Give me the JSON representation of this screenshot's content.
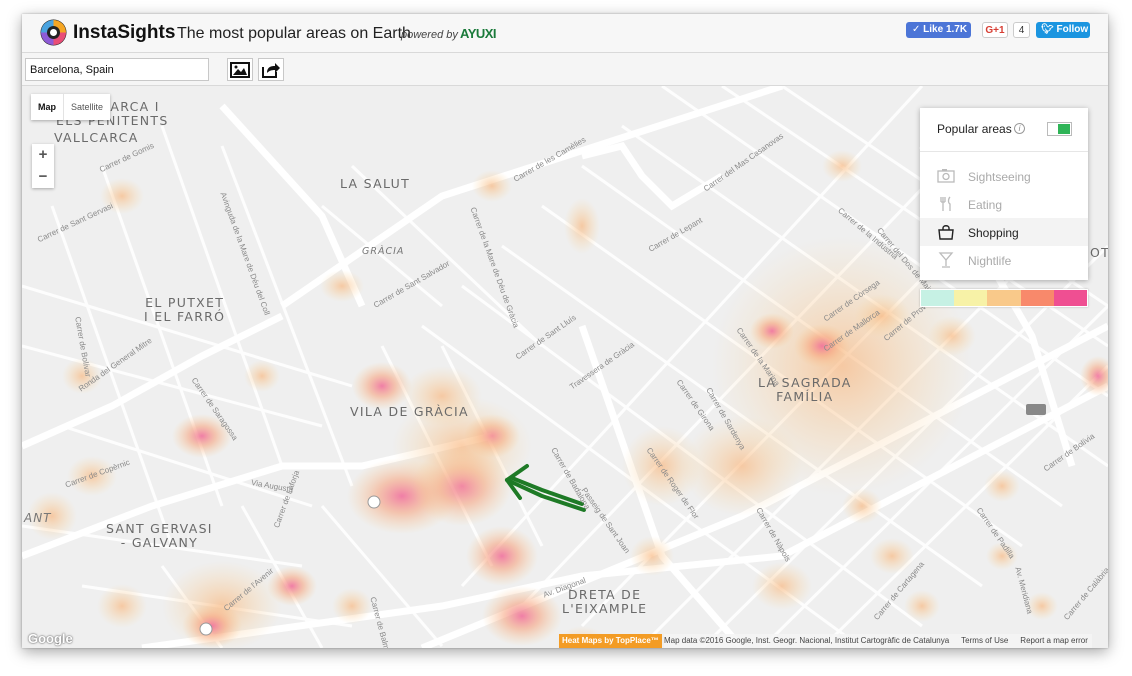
{
  "header": {
    "brand": "InstaSights",
    "tagline": "The most popular areas on Earth",
    "powered_by": "powered by",
    "partner": "AYUXI"
  },
  "social": {
    "like_label": "Like 1.7K",
    "gplus_label": "G+1",
    "gplus_count": "4",
    "follow_label": "Follow"
  },
  "search": {
    "value": "Barcelona, Spain"
  },
  "map_controls": {
    "map_label": "Map",
    "satellite_label": "Satellite",
    "zoom_in": "+",
    "zoom_out": "−"
  },
  "panel": {
    "title": "Popular areas",
    "info": "i",
    "toggle_on": true,
    "categories": [
      {
        "label": "Sightseeing",
        "icon": "camera-icon",
        "selected": false
      },
      {
        "label": "Eating",
        "icon": "fork-knife-icon",
        "selected": false
      },
      {
        "label": "Shopping",
        "icon": "shopping-bag-icon",
        "selected": true
      },
      {
        "label": "Nightlife",
        "icon": "cocktail-icon",
        "selected": false
      }
    ]
  },
  "legend_colors": [
    "#c6f1e4",
    "#f7f2a7",
    "#f9c98a",
    "#f8896b",
    "#ef4f92"
  ],
  "map": {
    "districts": [
      {
        "name": "VALLCARCA I\nELS PENITENTS",
        "key": "vallcarca_penitents"
      },
      {
        "name": "VALLCARCA",
        "key": "vallcarca"
      },
      {
        "name": "LA SALUT",
        "key": "la_salut"
      },
      {
        "name": "EL PUTXET\nI EL FARRÓ",
        "key": "putxet"
      },
      {
        "name": "VILA DE GRÀCIA",
        "key": "vila_gracia"
      },
      {
        "name": "LA SAGRADA\nFAMÍLIA",
        "key": "sagrada"
      },
      {
        "name": "SANT GERVASI\n- GALVANY",
        "key": "sant_gervasi"
      },
      {
        "name": "DRETA DE\nL'EIXAMPLE",
        "key": "dreta"
      }
    ],
    "gracia_label": "GRÀCIA",
    "left_edge_label": "ANT",
    "right_edge_label": "OT",
    "streets": [
      "Carrer de Gomis",
      "Avinguda de la Mare de Déu del Coll",
      "Carrer de Sant Gervasi",
      "Carrer de Bolívar",
      "Ronda del General Mitre",
      "Carrer de Copèrnic",
      "Via Augusta",
      "Carrer de Saragossa",
      "Carrer de Sant Salvador",
      "Carrer de la Mare de Déu de Gràcia",
      "Carrer de Balmes",
      "Carrer de Sant Lluís",
      "Travessera de Gràcia",
      "Carrer de Badalona",
      "Passeig de Sant Joan",
      "Carrer de Còrsega",
      "Carrer de Mallorca",
      "Carrer de Sardenya",
      "Carrer de Lepant",
      "Carrer de la Indústria",
      "Carrer del Dos de Maig",
      "Carrer de Provença",
      "Carrer de Padilla",
      "Carrer de Bolívia",
      "Av. Meridiana",
      "Av. Diagonal",
      "Carrer de Girona",
      "Carrer de la Marina",
      "Carrer de les Camèlies",
      "Carrer del Mas Casanovas",
      "Carrer de l'Avenir",
      "Carrer de Laforja",
      "Carrer de Calàbria",
      "Carrer de Roger de Flor",
      "Carrer de Nàpols",
      "Carrer de Cartagena"
    ],
    "google_logo": "Google",
    "heatmap_credit": "Heat Maps by TopPlace™",
    "map_data": "Map data ©2016 Google, Inst. Geogr. Nacional, Institut Cartogràfic de Catalunya",
    "terms": "Terms of Use",
    "report": "Report a map error"
  }
}
